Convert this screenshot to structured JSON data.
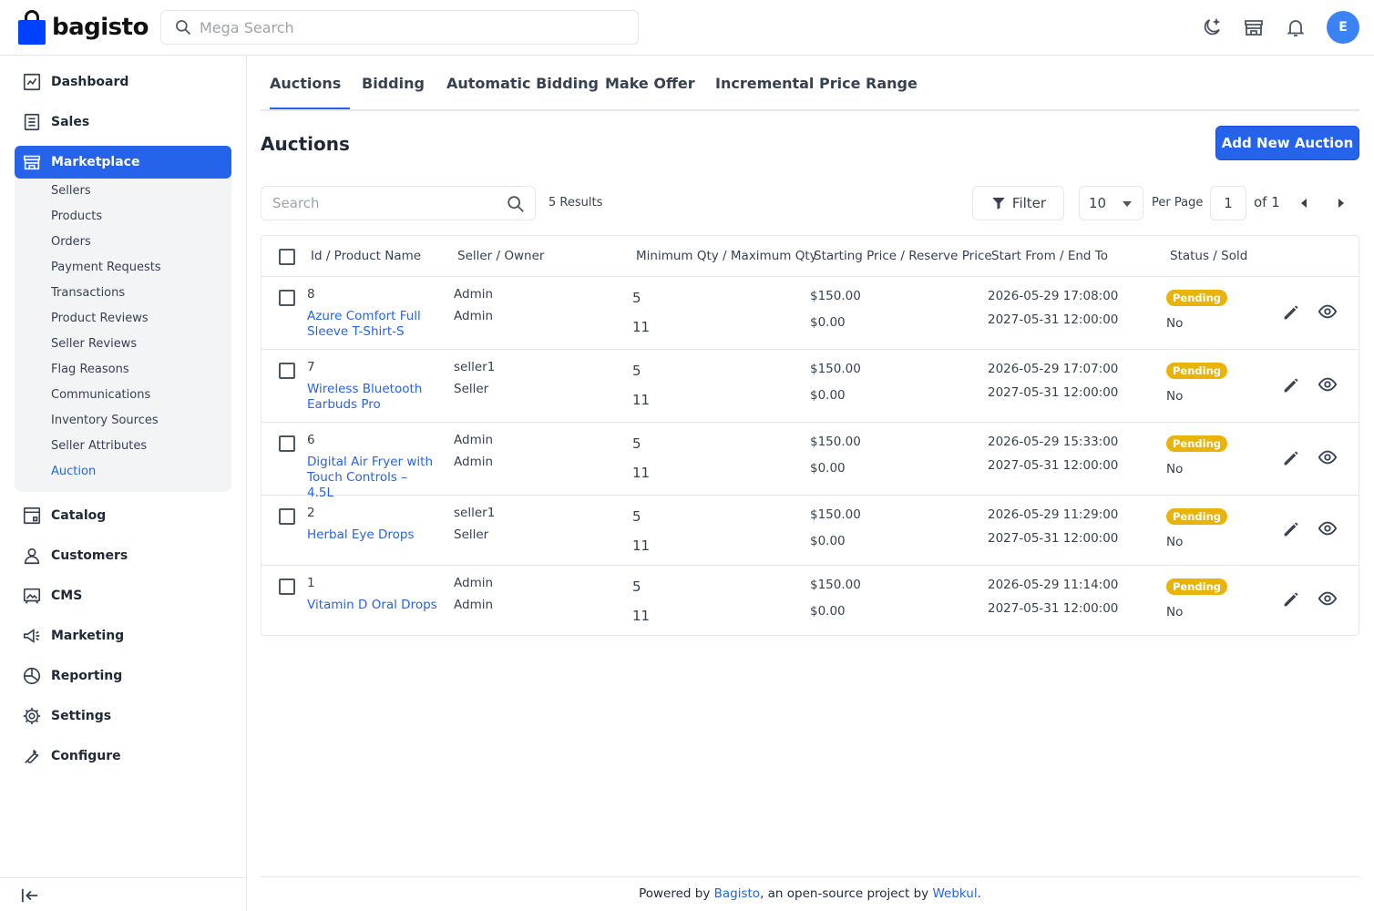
{
  "brand": {
    "name": "bagisto"
  },
  "search": {
    "placeholder": "Mega Search"
  },
  "user": {
    "initial": "E"
  },
  "colors": {
    "accent": "#2563eb",
    "brand_bag": "#0041ff",
    "badge_pending": "#eab308",
    "avatar": "#3b82f6"
  },
  "sidebar": {
    "items": [
      {
        "label": "Dashboard",
        "icon": "dashboard-icon"
      },
      {
        "label": "Sales",
        "icon": "sales-icon"
      },
      {
        "label": "Marketplace",
        "icon": "marketplace-icon"
      },
      {
        "label": "Catalog",
        "icon": "catalog-icon"
      },
      {
        "label": "Customers",
        "icon": "customers-icon"
      },
      {
        "label": "CMS",
        "icon": "cms-icon"
      },
      {
        "label": "Marketing",
        "icon": "marketing-icon"
      },
      {
        "label": "Reporting",
        "icon": "reporting-icon"
      },
      {
        "label": "Settings",
        "icon": "settings-icon"
      },
      {
        "label": "Configure",
        "icon": "configure-icon"
      }
    ],
    "marketplace_sub": [
      "Sellers",
      "Products",
      "Orders",
      "Payment Requests",
      "Transactions",
      "Product Reviews",
      "Seller Reviews",
      "Flag Reasons",
      "Communications",
      "Inventory Sources",
      "Seller Attributes",
      "Auction"
    ]
  },
  "tabs": [
    "Auctions",
    "Bidding",
    "Automatic Bidding",
    "Make Offer",
    "Incremental Price Range"
  ],
  "page": {
    "title": "Auctions",
    "add_button": "Add New Auction",
    "search_placeholder": "Search",
    "results": "5 Results",
    "filter": "Filter",
    "per_page_value": "10",
    "per_page_label": "Per Page",
    "current_page": "1",
    "of_pages": "of 1"
  },
  "table": {
    "headers": [
      "Id / Product Name",
      "Seller / Owner",
      "Minimum Qty / Maximum Qty",
      "Starting Price / Reserve Price",
      "Start From / End To",
      "Status / Sold"
    ],
    "rows": [
      {
        "id": "8",
        "name": "Azure Comfort Full Sleeve T-Shirt-S",
        "seller": "Admin",
        "owner": "Admin",
        "min_qty": "5",
        "max_qty": "11",
        "start_price": "$150.00",
        "reserve_price": "$0.00",
        "start": "2026-05-29 17:08:00",
        "end": "2027-05-31 12:00:00",
        "status": "Pending",
        "sold": "No"
      },
      {
        "id": "7",
        "name": "Wireless Bluetooth Earbuds Pro",
        "seller": "seller1",
        "owner": "Seller",
        "min_qty": "5",
        "max_qty": "11",
        "start_price": "$150.00",
        "reserve_price": "$0.00",
        "start": "2026-05-29 17:07:00",
        "end": "2027-05-31 12:00:00",
        "status": "Pending",
        "sold": "No"
      },
      {
        "id": "6",
        "name": "Digital Air Fryer with Touch Controls – 4.5L",
        "seller": "Admin",
        "owner": "Admin",
        "min_qty": "5",
        "max_qty": "11",
        "start_price": "$150.00",
        "reserve_price": "$0.00",
        "start": "2026-05-29 15:33:00",
        "end": "2027-05-31 12:00:00",
        "status": "Pending",
        "sold": "No"
      },
      {
        "id": "2",
        "name": "Herbal Eye Drops",
        "seller": "seller1",
        "owner": "Seller",
        "min_qty": "5",
        "max_qty": "11",
        "start_price": "$150.00",
        "reserve_price": "$0.00",
        "start": "2026-05-29 11:29:00",
        "end": "2027-05-31 12:00:00",
        "status": "Pending",
        "sold": "No"
      },
      {
        "id": "1",
        "name": "Vitamin D Oral Drops",
        "seller": "Admin",
        "owner": "Admin",
        "min_qty": "5",
        "max_qty": "11",
        "start_price": "$150.00",
        "reserve_price": "$0.00",
        "start": "2026-05-29 11:14:00",
        "end": "2027-05-31 12:00:00",
        "status": "Pending",
        "sold": "No"
      }
    ]
  },
  "footer": {
    "prefix": "Powered by ",
    "link1": "Bagisto",
    "middle": ", an open-source project by ",
    "link2": "Webkul",
    "suffix": "."
  }
}
